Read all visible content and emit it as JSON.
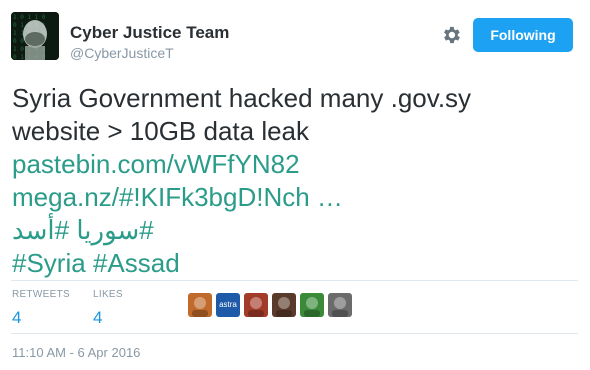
{
  "author": {
    "name": "Cyber Justice Team",
    "handle": "@CyberJusticeT"
  },
  "actions": {
    "follow_label": "Following",
    "settings_icon": "gear-icon"
  },
  "tweet": {
    "line1": "Syria Government hacked many .gov.sy",
    "line2": "website > 10GB data leak",
    "link1": "pastebin.com/vWFfYN82",
    "link2": "mega.nz/#!KIFk3bgD!Nch …",
    "hashtag_ar_1": "#سوريا",
    "hashtag_ar_2": "#أسد",
    "hashtag_en_1": "#Syria",
    "hashtag_en_2": "#Assad"
  },
  "stats": {
    "retweets_label": "RETWEETS",
    "retweets_value": "4",
    "likes_label": "LIKES",
    "likes_value": "4"
  },
  "likers": [
    {
      "name": "liker-avatar-1",
      "color": "#c06a2b"
    },
    {
      "name": "liker-avatar-2",
      "color": "#1e5aa8",
      "text": "astra"
    },
    {
      "name": "liker-avatar-3",
      "color": "#a33b2a"
    },
    {
      "name": "liker-avatar-4",
      "color": "#5a3a2a"
    },
    {
      "name": "liker-avatar-5",
      "color": "#3a8a3a"
    },
    {
      "name": "liker-avatar-6",
      "color": "#6b6b6b"
    }
  ],
  "timestamp": "11:10 AM - 6 Apr 2016",
  "colors": {
    "link": "#1b95e0",
    "accent": "#1da1f2",
    "muted": "#8899a6"
  }
}
